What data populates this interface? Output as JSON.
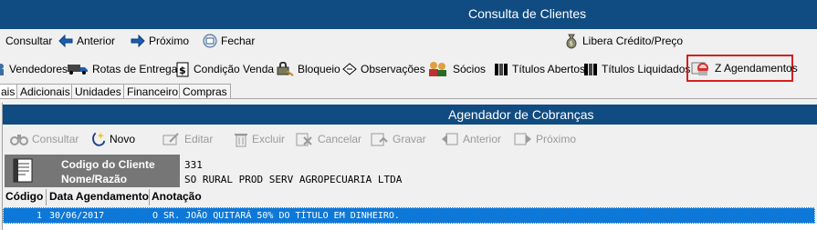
{
  "window": {
    "title": "Consulta de Clientes"
  },
  "toolbar1": {
    "consultar": "Consultar",
    "anterior": "Anterior",
    "proximo": "Próximo",
    "fechar": "Fechar",
    "libera": "Libera Crédito/Preço"
  },
  "toolbar2": {
    "vendedores": "Vendedores",
    "rotas": "Rotas de Entrega",
    "condicao": "Condição Venda",
    "bloqueio": "Bloqueio",
    "observacoes": "Observações",
    "socios": "Sócios",
    "titulos_abertos": "Títulos Abertos",
    "titulos_liquidados": "Títulos Liquidados",
    "agendamentos": "Z Agendamentos"
  },
  "tabs": [
    "ais",
    "Adicionais",
    "Unidades",
    "Financeiro",
    "Compras"
  ],
  "panel": {
    "title": "Agendador de Cobranças"
  },
  "toolbar3": {
    "consultar": "Consultar",
    "novo": "Novo",
    "editar": "Editar",
    "excluir": "Excluir",
    "cancelar": "Cancelar",
    "gravar": "Gravar",
    "anterior": "Anterior",
    "proximo": "Próximo"
  },
  "client": {
    "codigo_label": "Codigo do Cliente",
    "nome_label": "Nome/Razão",
    "codigo": "331",
    "nome": "SO RURAL PROD SERV AGROPECUARIA LTDA"
  },
  "grid": {
    "columns": [
      "Código",
      "Data Agendamento",
      "Anotação"
    ],
    "rows": [
      {
        "codigo": "1",
        "data": "30/06/2017",
        "anotacao": "O SR. JOÃO QUITARÁ 50% DO TÍTULO EM DINHEIRO."
      }
    ]
  },
  "colors": {
    "header_blue": "#104c82",
    "selection_blue": "#0e78d8",
    "highlight_red": "#d81e1e"
  }
}
